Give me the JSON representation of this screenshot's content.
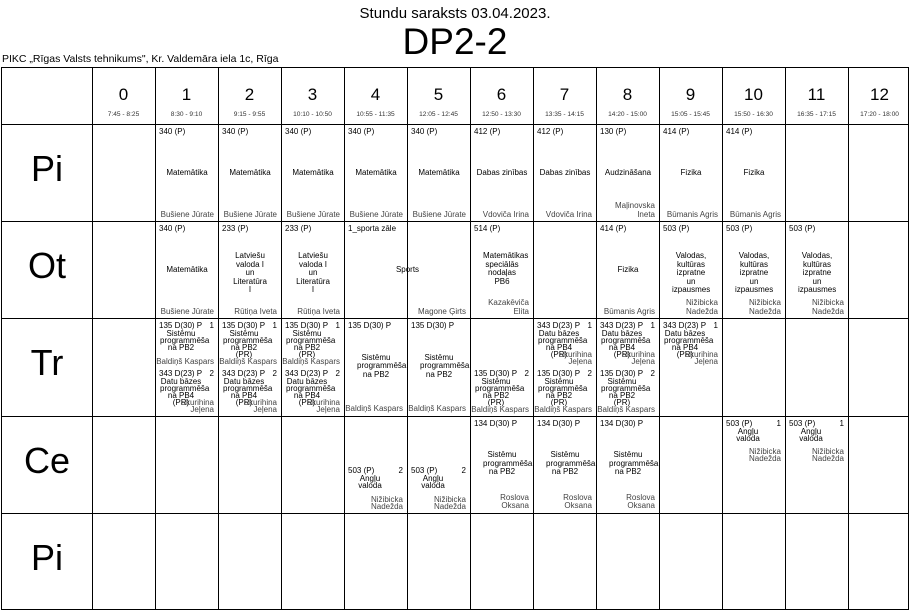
{
  "header": {
    "subtitle": "Stundu saraksts 03.04.2023.",
    "group": "DP2-2",
    "school": "PIKC „Rīgas Valsts tehnikums\", Kr. Valdemāra iela 1c, Rīga"
  },
  "periods": [
    {
      "num": "0",
      "time": "7:45 - 8:25"
    },
    {
      "num": "1",
      "time": "8:30 - 9:10"
    },
    {
      "num": "2",
      "time": "9:15 - 9:55"
    },
    {
      "num": "3",
      "time": "10:10 - 10:50"
    },
    {
      "num": "4",
      "time": "10:55 - 11:35"
    },
    {
      "num": "5",
      "time": "12:05 - 12:45"
    },
    {
      "num": "6",
      "time": "12:50 - 13:30"
    },
    {
      "num": "7",
      "time": "13:35 - 14:15"
    },
    {
      "num": "8",
      "time": "14:20 - 15:00"
    },
    {
      "num": "9",
      "time": "15:05 - 15:45"
    },
    {
      "num": "10",
      "time": "15:50 - 16:30"
    },
    {
      "num": "11",
      "time": "16:35 - 17:15"
    },
    {
      "num": "12",
      "time": "17:20 - 18:00"
    }
  ],
  "days": [
    "Pi",
    "Ot",
    "Tr",
    "Ce",
    "Pi"
  ],
  "lessons": [
    {
      "day": 0,
      "p": 1,
      "room": "340 (P)",
      "subject": "Matemātika",
      "teacher": "Bušiene Jūrate"
    },
    {
      "day": 0,
      "p": 2,
      "room": "340 (P)",
      "subject": "Matemātika",
      "teacher": "Bušiene Jūrate"
    },
    {
      "day": 0,
      "p": 3,
      "room": "340 (P)",
      "subject": "Matemātika",
      "teacher": "Bušiene Jūrate"
    },
    {
      "day": 0,
      "p": 4,
      "room": "340 (P)",
      "subject": "Matemātika",
      "teacher": "Bušiene Jūrate"
    },
    {
      "day": 0,
      "p": 5,
      "room": "340 (P)",
      "subject": "Matemātika",
      "teacher": "Bušiene Jūrate"
    },
    {
      "day": 0,
      "p": 6,
      "room": "412 (P)",
      "subject": "Dabas zinības",
      "teacher": "Vdoviča Irina"
    },
    {
      "day": 0,
      "p": 7,
      "room": "412 (P)",
      "subject": "Dabas zinības",
      "teacher": "Vdoviča Irina"
    },
    {
      "day": 0,
      "p": 8,
      "room": "130 (P)",
      "subject": "Audzināšana",
      "teacher": "Maļinovska Ineta"
    },
    {
      "day": 0,
      "p": 9,
      "room": "414 (P)",
      "subject": "Fizika",
      "teacher": "Būmanis Agris"
    },
    {
      "day": 0,
      "p": 10,
      "room": "414 (P)",
      "subject": "Fizika",
      "teacher": "Būmanis Agris"
    },
    {
      "day": 1,
      "p": 1,
      "room": "340 (P)",
      "subject": "Matemātika",
      "teacher": "Bušiene Jūrate"
    },
    {
      "day": 1,
      "p": 2,
      "room": "233 (P)",
      "subject": "Latviešu valoda I un Literatūra I",
      "teacher": "Rūtiņa Iveta"
    },
    {
      "day": 1,
      "p": 3,
      "room": "233 (P)",
      "subject": "Latviešu valoda I un Literatūra I",
      "teacher": "Rūtiņa Iveta"
    },
    {
      "day": 1,
      "p": 4,
      "span": 2,
      "room": "1_sporta zāle",
      "subject": "Sports",
      "teacher": "Magone Ģirts"
    },
    {
      "day": 1,
      "p": 6,
      "room": "514 (P)",
      "subject": "Matemātikas speciālās nodaļas PB6",
      "teacher": "Kazakēviča Elita"
    },
    {
      "day": 1,
      "p": 8,
      "room": "414 (P)",
      "subject": "Fizika",
      "teacher": "Būmanis Agris"
    },
    {
      "day": 1,
      "p": 9,
      "room": "503 (P)",
      "subject": "Valodas, kultūras izpratne un izpausmes",
      "teacher": "Nižibicka Nadežda"
    },
    {
      "day": 1,
      "p": 10,
      "room": "503 (P)",
      "subject": "Valodas, kultūras izpratne un izpausmes",
      "teacher": "Nižibicka Nadežda"
    },
    {
      "day": 1,
      "p": 11,
      "room": "503 (P)",
      "subject": "Valodas, kultūras izpratne un izpausmes",
      "teacher": "Nižibicka Nadežda"
    },
    {
      "day": 2,
      "p": 1,
      "half": "top",
      "room": "135 D(30) P",
      "grp": "1",
      "subject": "Sistēmu programmēša na PB2",
      "teacher": "Baldiņš Kaspars"
    },
    {
      "day": 2,
      "p": 1,
      "half": "bot",
      "room": "343 D(23) P",
      "grp": "2",
      "subject": "Datu bāzes programmēša na PB4 (PR)",
      "teacher": "Skurihina Jeļena"
    },
    {
      "day": 2,
      "p": 2,
      "half": "top",
      "room": "135 D(30) P",
      "grp": "1",
      "subject": "Sistēmu programmēša na PB2 (PR)",
      "teacher": "Baldiņš Kaspars"
    },
    {
      "day": 2,
      "p": 2,
      "half": "bot",
      "room": "343 D(23) P",
      "grp": "2",
      "subject": "Datu bāzes programmēša na PB4 (PR)",
      "teacher": "Skurihina Jeļena"
    },
    {
      "day": 2,
      "p": 3,
      "half": "top",
      "room": "135 D(30) P",
      "grp": "1",
      "subject": "Sistēmu programmēša na PB2 (PR)",
      "teacher": "Baldiņš Kaspars"
    },
    {
      "day": 2,
      "p": 3,
      "half": "bot",
      "room": "343 D(23) P",
      "grp": "2",
      "subject": "Datu bāzes programmēša na PB4 (PR)",
      "teacher": "Skurihina Jeļena"
    },
    {
      "day": 2,
      "p": 4,
      "room": "135 D(30) P",
      "subject": "Sistēmu programmēša na PB2",
      "teacher": "Baldiņš Kaspars"
    },
    {
      "day": 2,
      "p": 5,
      "room": "135 D(30) P",
      "subject": "Sistēmu programmēša na PB2",
      "teacher": "Baldiņš Kaspars"
    },
    {
      "day": 2,
      "p": 6,
      "half": "bot",
      "room": "135 D(30) P",
      "grp": "2",
      "subject": "Sistēmu programmēša na PB2 (PR)",
      "teacher": "Baldiņš Kaspars"
    },
    {
      "day": 2,
      "p": 7,
      "half": "top",
      "room": "343 D(23) P",
      "grp": "1",
      "subject": "Datu bāzes programmēša na PB4 (PR)",
      "teacher": "Skurihina Jeļena"
    },
    {
      "day": 2,
      "p": 7,
      "half": "bot",
      "room": "135 D(30) P",
      "grp": "2",
      "subject": "Sistēmu programmēša na PB2 (PR)",
      "teacher": "Baldiņš Kaspars"
    },
    {
      "day": 2,
      "p": 8,
      "half": "top",
      "room": "343 D(23) P",
      "grp": "1",
      "subject": "Datu bāzes programmēša na PB4 (PR)",
      "teacher": "Skurihina Jeļena"
    },
    {
      "day": 2,
      "p": 8,
      "half": "bot",
      "room": "135 D(30) P",
      "grp": "2",
      "subject": "Sistēmu programmēša na PB2 (PR)",
      "teacher": "Baldiņš Kaspars"
    },
    {
      "day": 2,
      "p": 9,
      "half": "top",
      "room": "343 D(23) P",
      "grp": "1",
      "subject": "Datu bāzes programmēša na PB4 (PR)",
      "teacher": "Skurihina Jeļena"
    },
    {
      "day": 3,
      "p": 4,
      "half": "bot",
      "room": "503 (P)",
      "grp": "2",
      "subject": "Angļu valoda",
      "teacher": "Nižibicka Nadežda"
    },
    {
      "day": 3,
      "p": 5,
      "half": "bot",
      "room": "503 (P)",
      "grp": "2",
      "subject": "Angļu valoda",
      "teacher": "Nižibicka Nadežda"
    },
    {
      "day": 3,
      "p": 6,
      "room": "134 D(30) P",
      "subject": "Sistēmu programmēša na PB2",
      "teacher": "Roslova Oksana"
    },
    {
      "day": 3,
      "p": 7,
      "room": "134 D(30) P",
      "subject": "Sistēmu programmēša na PB2",
      "teacher": "Roslova Oksana"
    },
    {
      "day": 3,
      "p": 8,
      "room": "134 D(30) P",
      "subject": "Sistēmu programmēša na PB2",
      "teacher": "Roslova Oksana"
    },
    {
      "day": 3,
      "p": 10,
      "half": "top",
      "room": "503 (P)",
      "grp": "1",
      "subject": "Angļu valoda",
      "teacher": "Nižibicka Nadežda"
    },
    {
      "day": 3,
      "p": 11,
      "half": "top",
      "room": "503 (P)",
      "grp": "1",
      "subject": "Angļu valoda",
      "teacher": "Nižibicka Nadežda"
    }
  ]
}
